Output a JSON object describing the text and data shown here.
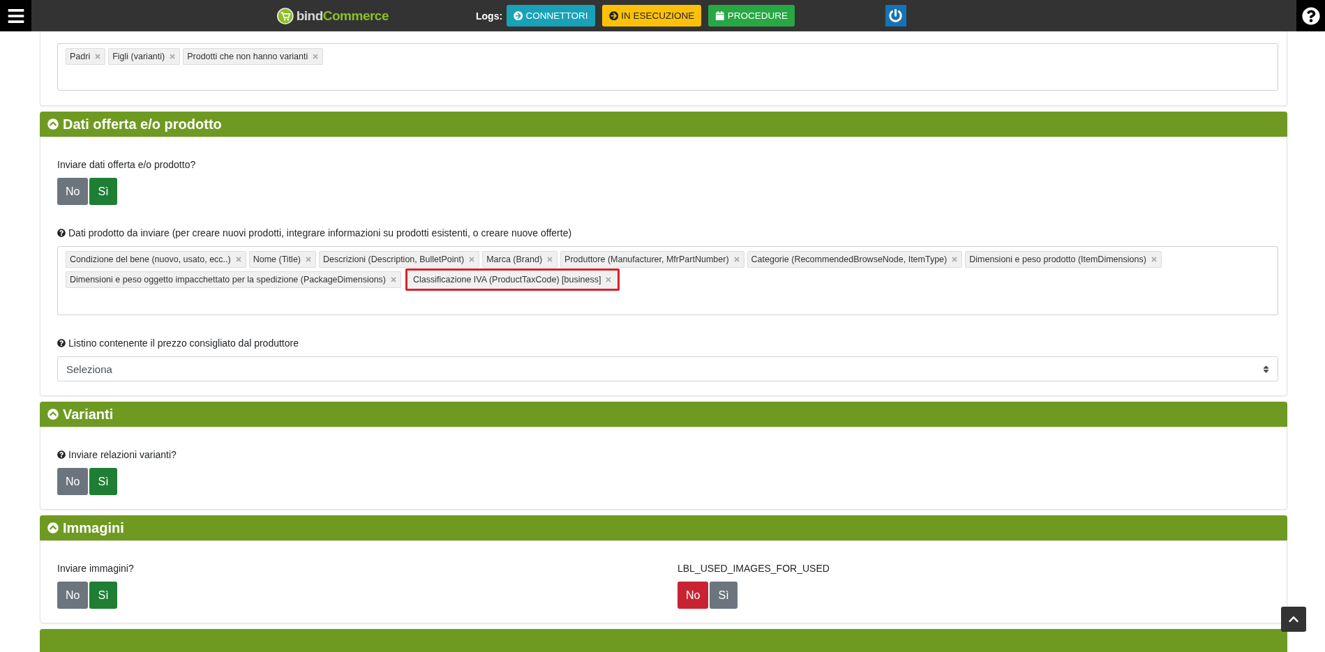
{
  "header": {
    "logo": {
      "parts": [
        "bind",
        "Commerce"
      ]
    },
    "logs_label": "Logs:",
    "log_buttons": [
      {
        "label": "CONNETTORI",
        "kind": "connectors"
      },
      {
        "label": "IN ESECUZIONE",
        "kind": "running"
      },
      {
        "label": "PROCEDURE",
        "kind": "procedures"
      }
    ]
  },
  "top_panel": {
    "tags": [
      {
        "label": "Padri",
        "highlighted": false
      },
      {
        "label": "Figli (varianti)",
        "highlighted": false
      },
      {
        "label": "Prodotti che non hanno varianti",
        "highlighted": false
      }
    ]
  },
  "sections": [
    {
      "title": "Dati offerta e/o prodotto",
      "expanded": true,
      "fields": [
        {
          "kind": "toggle",
          "label": "Inviare dati offerta e/o prodotto?",
          "help": false,
          "options": [
            {
              "label": "No",
              "kind": "no",
              "selected": false
            },
            {
              "label": "Sì",
              "kind": "yes",
              "selected": true
            }
          ]
        },
        {
          "kind": "tags",
          "label": "Dati prodotto da inviare (per creare nuovi prodotti, integrare informazioni su prodotti esistenti, o creare nuove offerte)",
          "help": true,
          "tags": [
            {
              "label": "Condizione del bene (nuovo, usato, ecc..)",
              "highlighted": false
            },
            {
              "label": "Nome (Title)",
              "highlighted": false
            },
            {
              "label": "Descrizioni (Description, BulletPoint)",
              "highlighted": false
            },
            {
              "label": "Marca (Brand)",
              "highlighted": false
            },
            {
              "label": "Produttore (Manufacturer, MfrPartNumber)",
              "highlighted": false
            },
            {
              "label": "Categorie (RecommendedBrowseNode, ItemType)",
              "highlighted": false
            },
            {
              "label": "Dimensioni e peso prodotto (ItemDimensions)",
              "highlighted": false
            },
            {
              "label": "Dimensioni e peso oggetto impacchettato per la spedizione (PackageDimensions)",
              "highlighted": false
            },
            {
              "label": "Classificazione IVA (ProductTaxCode) [business]",
              "highlighted": true
            }
          ]
        },
        {
          "kind": "select",
          "label": "Listino contenente il prezzo consigliato dal produttore",
          "help": true,
          "value": "Seleziona"
        }
      ]
    },
    {
      "title": "Varianti",
      "expanded": true,
      "fields": [
        {
          "kind": "toggle",
          "label": "Inviare relazioni varianti?",
          "help": true,
          "options": [
            {
              "label": "No",
              "kind": "no",
              "selected": false
            },
            {
              "label": "Sì",
              "kind": "yes",
              "selected": true
            }
          ]
        }
      ]
    },
    {
      "title": "Immagini",
      "expanded": true,
      "fields": [
        {
          "kind": "row",
          "fields": [
            {
              "kind": "toggle",
              "label": "Inviare immagini?",
              "help": false,
              "options": [
                {
                  "label": "No",
                  "kind": "no",
                  "selected": false
                },
                {
                  "label": "Sì",
                  "kind": "yes",
                  "selected": true
                }
              ]
            },
            {
              "kind": "toggle",
              "label": "LBL_USED_IMAGES_FOR_USED",
              "help": false,
              "options": [
                {
                  "label": "No",
                  "kind": "no",
                  "selected": true
                },
                {
                  "label": "Sì",
                  "kind": "yes",
                  "selected": false
                }
              ]
            }
          ]
        }
      ]
    }
  ]
}
